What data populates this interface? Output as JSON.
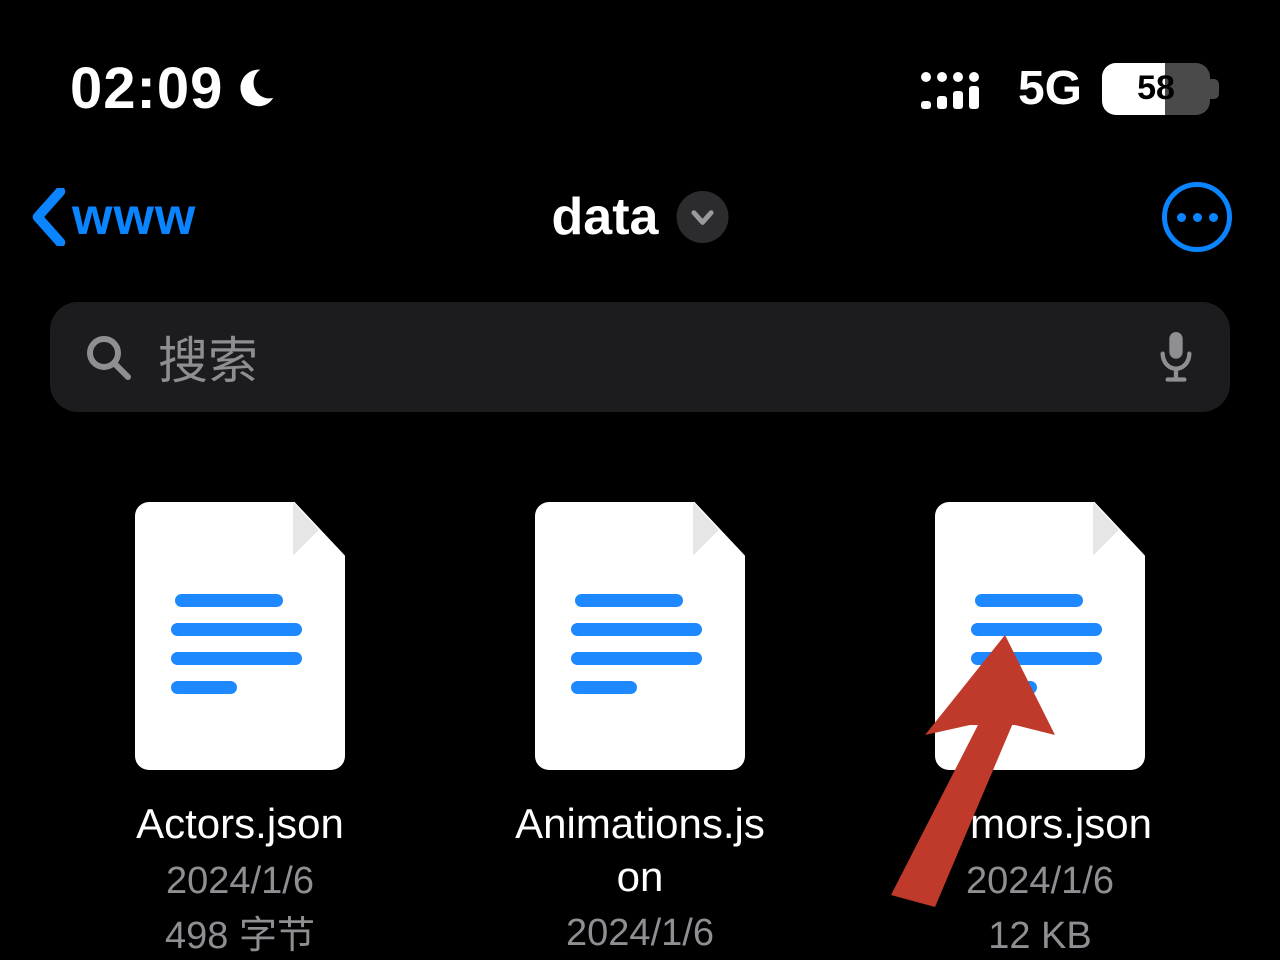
{
  "status": {
    "time": "02:09",
    "do_not_disturb": true,
    "network": "5G",
    "battery_percent": "58"
  },
  "nav": {
    "back_label": "www",
    "title": "data"
  },
  "search": {
    "placeholder": "搜索"
  },
  "files": [
    {
      "name": "Actors.json",
      "date": "2024/1/6",
      "size": "498 字节"
    },
    {
      "name": "Animations.json",
      "date": "2024/1/6",
      "size": ""
    },
    {
      "name": "Armors.json",
      "date": "2024/1/6",
      "size": "12 KB"
    }
  ],
  "colors": {
    "accent": "#0a84ff",
    "search_bg": "#1c1c1e",
    "muted": "#8e8e93",
    "annotation": "#c0392b"
  }
}
